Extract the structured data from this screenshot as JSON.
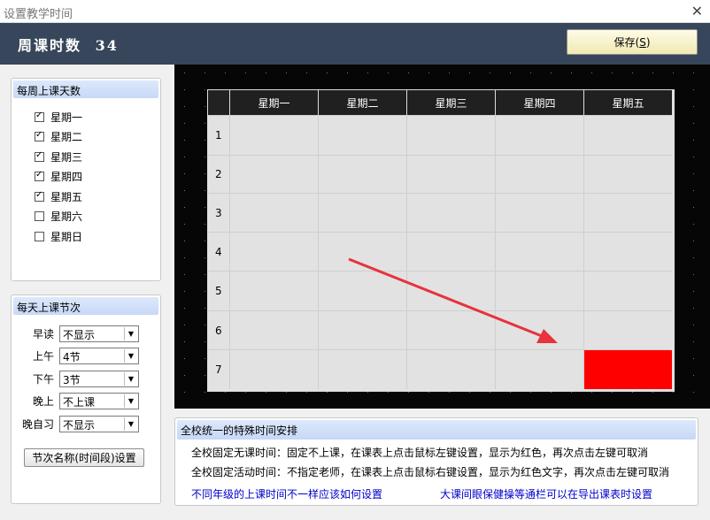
{
  "window": {
    "title": "设置教学时间",
    "close_glyph": "✕"
  },
  "header": {
    "hours_label": "周课时数",
    "hours_value": "34",
    "save_label": "保存(",
    "save_hotkey": "S",
    "save_suffix": ")"
  },
  "days": {
    "heading": "每周上课天数",
    "items": [
      {
        "label": "星期一",
        "checked": true
      },
      {
        "label": "星期二",
        "checked": true
      },
      {
        "label": "星期三",
        "checked": true
      },
      {
        "label": "星期四",
        "checked": true
      },
      {
        "label": "星期五",
        "checked": true
      },
      {
        "label": "星期六",
        "checked": false
      },
      {
        "label": "星期日",
        "checked": false
      }
    ]
  },
  "lessons": {
    "heading": "每天上课节次",
    "rows": [
      {
        "label": "早读",
        "value": "不显示"
      },
      {
        "label": "上午",
        "value": "4节"
      },
      {
        "label": "下午",
        "value": "3节"
      },
      {
        "label": "晚上",
        "value": "不上课"
      },
      {
        "label": "晚自习",
        "value": "不显示"
      }
    ],
    "period_button": "节次名称(时间段)设置"
  },
  "timetable": {
    "days": [
      "星期一",
      "星期二",
      "星期三",
      "星期四",
      "星期五"
    ],
    "periods": [
      "1",
      "2",
      "3",
      "4",
      "5",
      "6",
      "7"
    ],
    "red_cells": [
      {
        "period": 7,
        "day": 5
      }
    ]
  },
  "info": {
    "heading": "全校统一的特殊时间安排",
    "line1": "全校固定无课时间：固定不上课，在课表上点击鼠标左键设置，显示为红色，再次点击左键可取消",
    "line2": "全校固定活动时间：不指定老师，在课表上点击鼠标右键设置，显示为红色文字，再次点击左键可取消",
    "link1": "不同年级的上课时间不一样应该如何设置",
    "link2": "大课间眼保健操等通栏可以在导出课表时设置"
  },
  "colors": {
    "header_bg": "#37465a",
    "red_cell": "#ff0000",
    "arrow": "#e8323c"
  },
  "icons": {
    "close": "close-icon",
    "dropdown": "chevron-down-icon",
    "check": "check-icon"
  }
}
